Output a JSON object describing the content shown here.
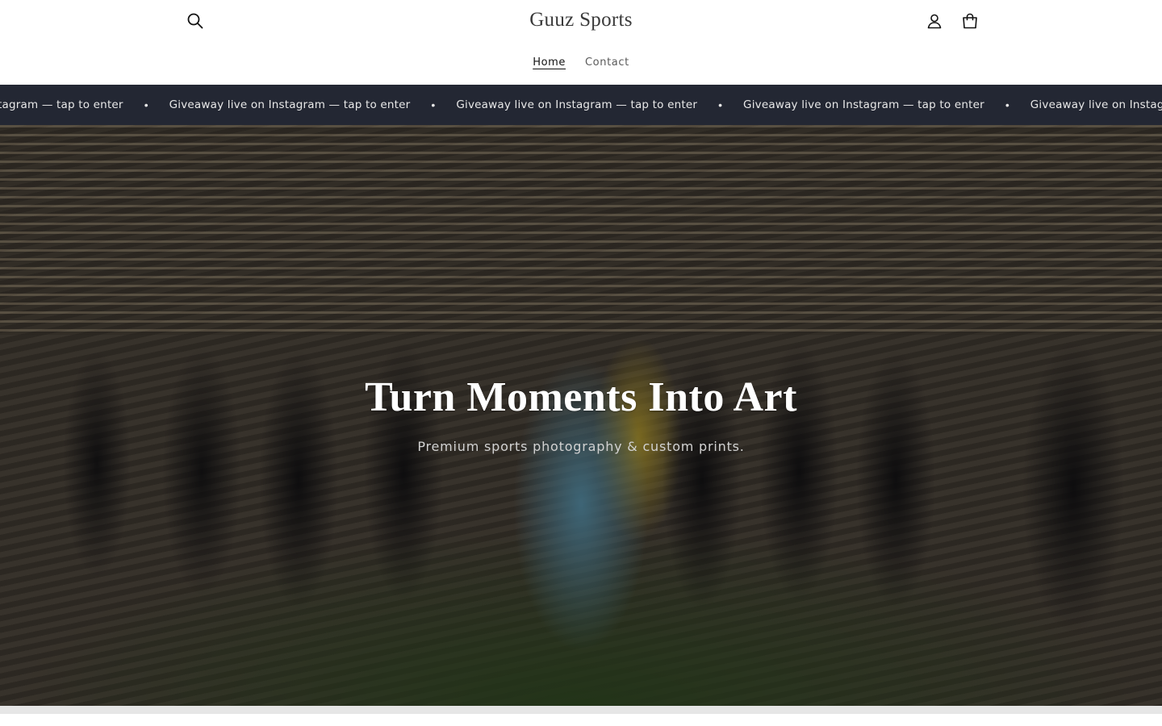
{
  "header": {
    "logo_text": "Guuz Sports",
    "icons": {
      "search": "search-icon",
      "account": "user-icon",
      "cart": "cart-icon"
    }
  },
  "nav": {
    "items": [
      {
        "label": "Home",
        "active": true
      },
      {
        "label": "Contact",
        "active": false
      }
    ]
  },
  "announcement": {
    "items": [
      "ive on Instagram — tap to enter",
      "Giveaway live on Instagram — tap to enter",
      "Giveaway live on Instagram — tap to enter",
      "Giveaway live on Instagram — tap to enter",
      "Giveaway live on Instagram — tap to enter"
    ],
    "separator": "•"
  },
  "hero": {
    "title": "Turn Moments Into Art",
    "subtitle": "Premium sports photography & custom prints."
  },
  "colors": {
    "announcement_bg": "#232733",
    "announcement_text": "#e8e8e8",
    "hero_title": "#ffffff",
    "logo": "#3a3a3a"
  }
}
